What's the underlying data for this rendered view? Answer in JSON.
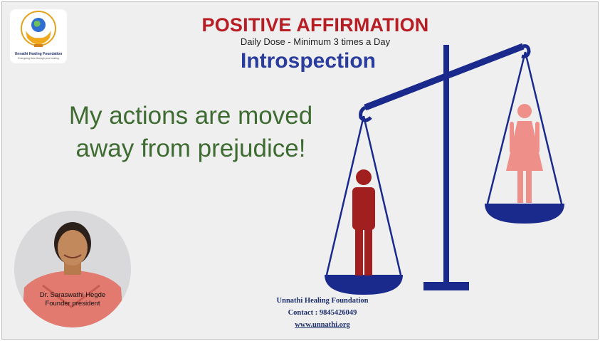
{
  "logo": {
    "org_name": "Unnathi Healing Foundation",
    "tagline": "Energizing lives through your healing",
    "icon": "globe-in-hands-logo"
  },
  "header": {
    "title": "POSITIVE AFFIRMATION",
    "subtitle": "Daily Dose - Minimum 3 times a Day",
    "section": "Introspection"
  },
  "affirmation": {
    "line1": "My  actions are moved",
    "line2": "away from prejudice!"
  },
  "portrait": {
    "name": "Dr. Saraswathi Hegde",
    "role": "Founder president"
  },
  "footer": {
    "org": "Unnathi Healing Foundation",
    "contact": "Contact : 9845426049",
    "website": "www.unnathi.org"
  },
  "colors": {
    "title": "#b81d24",
    "section": "#2a3c9d",
    "affirmation": "#3e6b31",
    "scale": "#1a2a8c",
    "man": "#a21f1f",
    "woman": "#ef8f8a"
  }
}
